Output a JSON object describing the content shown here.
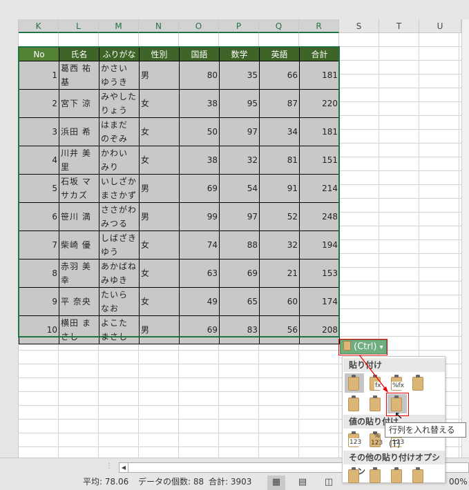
{
  "columns": [
    "K",
    "L",
    "M",
    "N",
    "O",
    "P",
    "Q",
    "R",
    "S",
    "T",
    "U"
  ],
  "table": {
    "headers": [
      "No",
      "氏名",
      "ふりがな",
      "性別",
      "国語",
      "数学",
      "英語",
      "合計"
    ],
    "rows": [
      [
        "1",
        "葛西 祐基",
        "かさい ゆうき",
        "男",
        "80",
        "35",
        "66",
        "181"
      ],
      [
        "2",
        "宮下 涼",
        "みやした りょう",
        "女",
        "38",
        "95",
        "87",
        "220"
      ],
      [
        "3",
        "浜田 希",
        "はまだ のぞみ",
        "女",
        "50",
        "97",
        "34",
        "181"
      ],
      [
        "4",
        "川井 美里",
        "かわい みり",
        "女",
        "38",
        "32",
        "81",
        "151"
      ],
      [
        "5",
        "石坂 マサカズ",
        "いしざか まさかず",
        "男",
        "69",
        "54",
        "91",
        "214"
      ],
      [
        "6",
        "笹川 満",
        "ささがわ みつる",
        "男",
        "99",
        "97",
        "52",
        "248"
      ],
      [
        "7",
        "柴崎 優",
        "しばざき ゆう",
        "女",
        "74",
        "88",
        "32",
        "194"
      ],
      [
        "8",
        "赤羽 美幸",
        "あかばね みゆき",
        "女",
        "63",
        "69",
        "21",
        "153"
      ],
      [
        "9",
        "平 奈央",
        "たいら なお",
        "女",
        "49",
        "65",
        "60",
        "174"
      ],
      [
        "10",
        "横田 まさし",
        "よこた まさし",
        "男",
        "69",
        "83",
        "56",
        "208"
      ]
    ]
  },
  "paste_button": {
    "label": "(Ctrl)",
    "arrow": "▾"
  },
  "paste_menu": {
    "section_paste": "貼り付け",
    "section_values": "値の貼り付け",
    "section_other": "その他の貼り付けオプション",
    "tooltip": "行列を入れ替える (T)",
    "icon_labels": {
      "formula": "fx",
      "percent_formula": "%fx",
      "values": "123",
      "percent_values": "%\n123"
    }
  },
  "status": {
    "average": "平均: 78.06",
    "count": "データの個数: 88",
    "sum": "合計: 3903",
    "zoom": "00%"
  }
}
